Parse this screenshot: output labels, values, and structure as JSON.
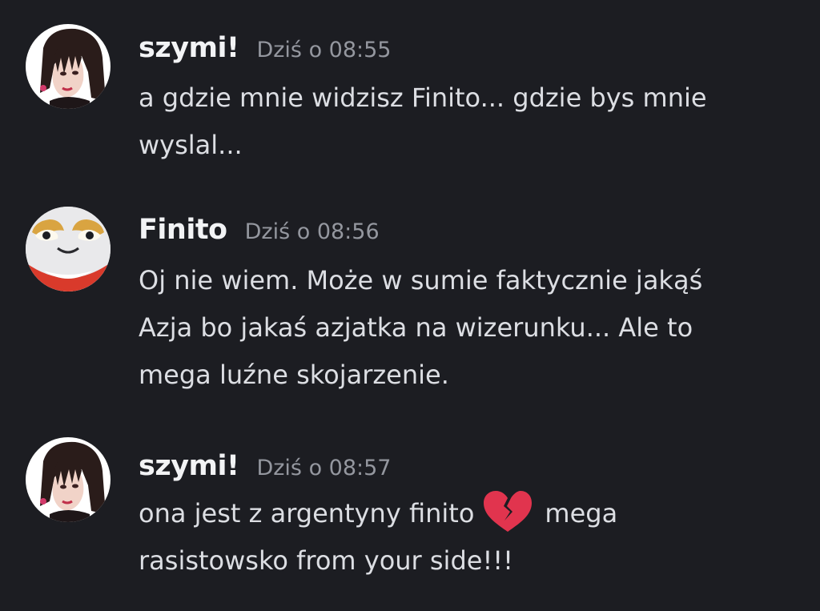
{
  "messages": [
    {
      "author": "szymi!",
      "timestamp": "Dziś o 08:55",
      "avatar": "anime-girl-avatar",
      "lines": [
        "a gdzie mnie widzisz Finito... gdzie bys mnie",
        "wyslal..."
      ]
    },
    {
      "author": "Finito",
      "timestamp": "Dziś o 08:56",
      "avatar": "mask-face-avatar",
      "lines": [
        "Oj nie wiem. Może w sumie faktycznie jakąś",
        "Azja bo jakaś azjatka na wizerunku... Ale to",
        "mega luźne skojarzenie."
      ]
    },
    {
      "author": "szymi!",
      "timestamp": "Dziś o 08:57",
      "avatar": "anime-girl-avatar",
      "line1_before_emoji": "ona jest z argentyny finito",
      "emoji": "broken-heart-icon",
      "line1_after_emoji": "mega",
      "line2": "rasistowsko from your side!!!"
    }
  ],
  "colors": {
    "background": "#1c1d22",
    "username": "#f2f3f5",
    "timestamp": "#94979f",
    "message_text": "#dcdee3",
    "broken_heart": "#e1344e"
  }
}
